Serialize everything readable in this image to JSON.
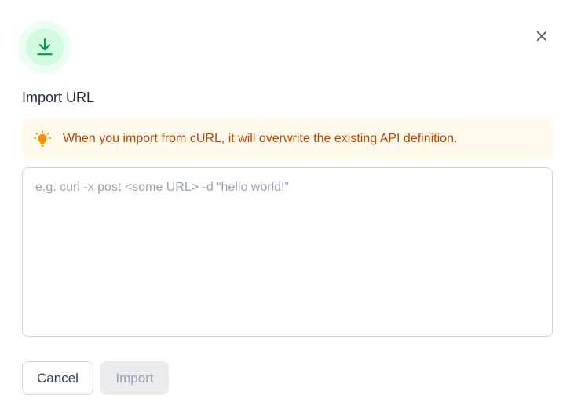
{
  "dialog": {
    "title": "Import URL",
    "header_icon": "download-icon",
    "close_icon": "close-icon",
    "alert": {
      "icon": "lightbulb-icon",
      "text": "When you import from cURL, it will overwrite the existing API definition."
    },
    "input": {
      "value": "",
      "placeholder": "e.g. curl -x post <some URL> -d “hello world!”"
    },
    "buttons": {
      "cancel_label": "Cancel",
      "import_label": "Import",
      "import_disabled": true
    },
    "colors": {
      "icon_green": "#039855",
      "icon_bg_outer": "#ecfdf3",
      "icon_bg_inner": "#d1fadf",
      "alert_bg": "#fffaeb",
      "alert_text": "#b54708",
      "alert_icon": "#f79009"
    }
  }
}
